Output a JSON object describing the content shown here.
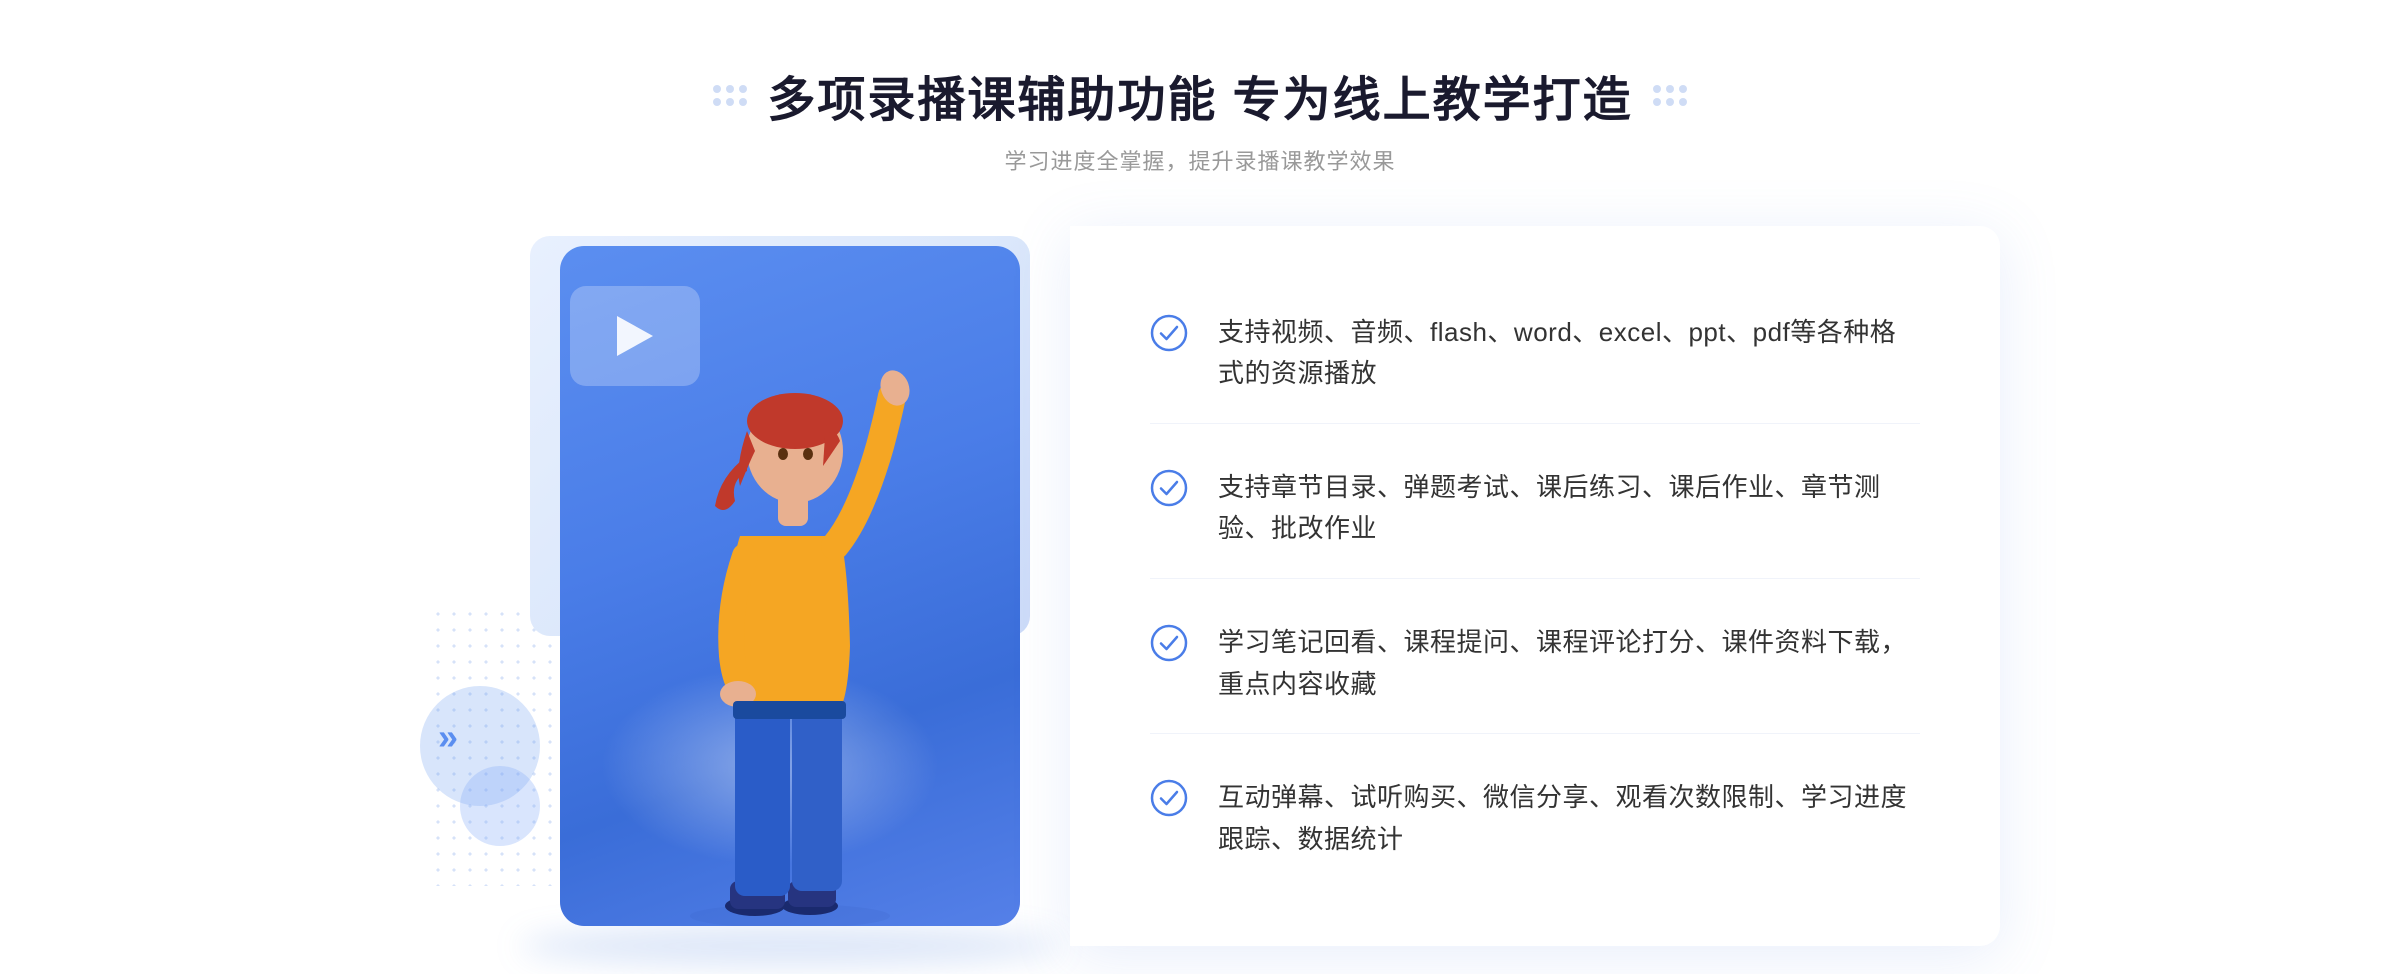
{
  "page": {
    "title": "多项录播课辅助功能 专为线上教学打造",
    "subtitle": "学习进度全掌握，提升录播课教学效果"
  },
  "features": [
    {
      "id": "feature-1",
      "text": "支持视频、音频、flash、word、excel、ppt、pdf等各种格式的资源播放"
    },
    {
      "id": "feature-2",
      "text": "支持章节目录、弹题考试、课后练习、课后作业、章节测验、批改作业"
    },
    {
      "id": "feature-3",
      "text": "学习笔记回看、课程提问、课程评论打分、课件资料下载，重点内容收藏"
    },
    {
      "id": "feature-4",
      "text": "互动弹幕、试听购买、微信分享、观看次数限制、学习进度跟踪、数据统计"
    }
  ],
  "colors": {
    "accent_blue": "#4a7de8",
    "light_blue": "#e8f0fe",
    "text_dark": "#1a1a2e",
    "text_gray": "#999999",
    "text_body": "#333333"
  }
}
